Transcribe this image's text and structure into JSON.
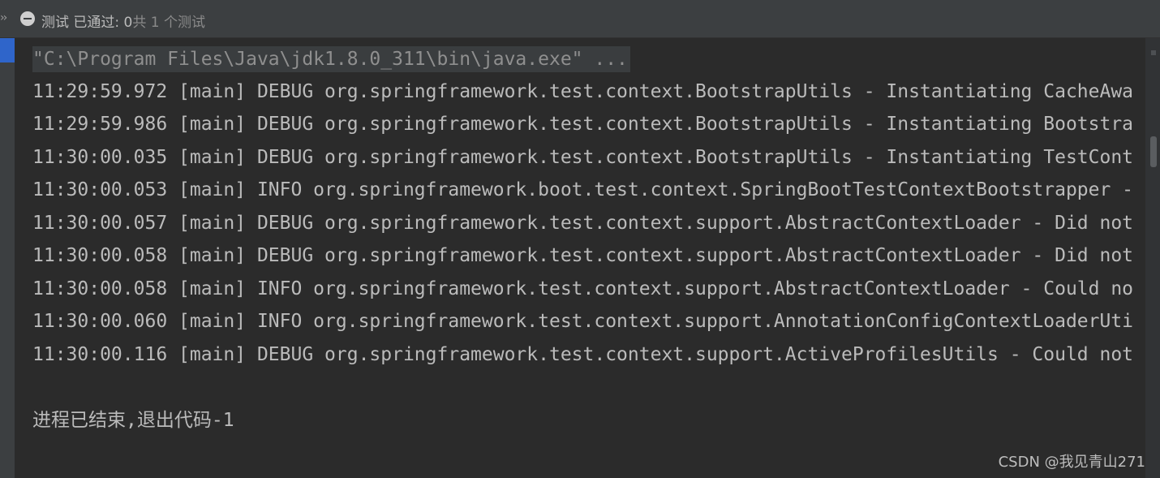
{
  "header": {
    "expand_glyph": "››",
    "status_icon": "minus-circle-icon",
    "status_prefix": "测试 已通过: 0",
    "status_suffix": "共 1 个测试"
  },
  "console": {
    "command": "\"C:\\Program Files\\Java\\jdk1.8.0_311\\bin\\java.exe\" ...",
    "lines": [
      "11:29:59.972 [main] DEBUG org.springframework.test.context.BootstrapUtils - Instantiating CacheAwa",
      "11:29:59.986 [main] DEBUG org.springframework.test.context.BootstrapUtils - Instantiating Bootstra",
      "11:30:00.035 [main] DEBUG org.springframework.test.context.BootstrapUtils - Instantiating TestCont",
      "11:30:00.053 [main] INFO org.springframework.boot.test.context.SpringBootTestContextBootstrapper -",
      "11:30:00.057 [main] DEBUG org.springframework.test.context.support.AbstractContextLoader - Did not",
      "11:30:00.058 [main] DEBUG org.springframework.test.context.support.AbstractContextLoader - Did not",
      "11:30:00.058 [main] INFO org.springframework.test.context.support.AbstractContextLoader - Could no",
      "11:30:00.060 [main] INFO org.springframework.test.context.support.AnnotationConfigContextLoaderUti",
      "11:30:00.116 [main] DEBUG org.springframework.test.context.support.ActiveProfilesUtils - Could not"
    ],
    "exit_message": "进程已结束,退出代码-1"
  },
  "watermark": "CSDN @我见青山271",
  "colors": {
    "background": "#2b2b2b",
    "toolbar": "#3c3f41",
    "text": "#bbbbbb",
    "command_highlight": "#3a3d3f",
    "gutter_accent": "#2f65ca"
  }
}
